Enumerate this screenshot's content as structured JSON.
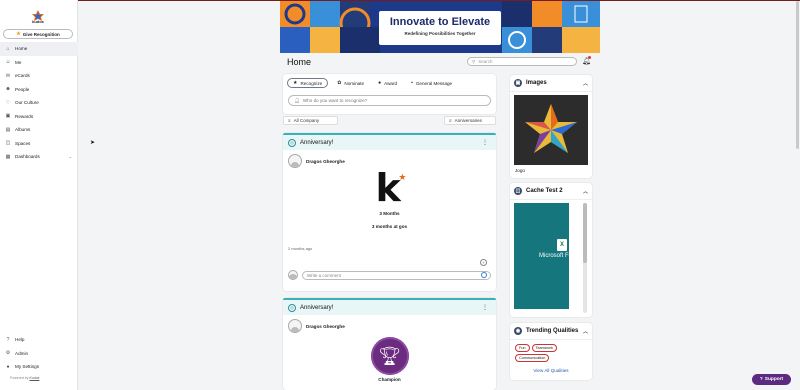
{
  "brand": {
    "logo_text": "kudos",
    "accent": "#e46b1a"
  },
  "sidebar": {
    "give_recognition": "Give Recognition",
    "items": [
      {
        "label": "Home",
        "icon": "home-icon",
        "glyph": "⌂",
        "active": true
      },
      {
        "label": "Me",
        "icon": "user-icon",
        "glyph": "☺"
      },
      {
        "label": "eCards",
        "icon": "envelope-icon",
        "glyph": "✉"
      },
      {
        "label": "People",
        "icon": "people-icon",
        "glyph": "☻"
      },
      {
        "label": "Our Culture",
        "icon": "heart-icon",
        "glyph": "♡"
      },
      {
        "label": "Rewards",
        "icon": "gift-icon",
        "glyph": "▣"
      },
      {
        "label": "Albums",
        "icon": "album-icon",
        "glyph": "▤"
      },
      {
        "label": "Spaces",
        "icon": "spaces-icon",
        "glyph": "◫"
      },
      {
        "label": "Dashboards",
        "icon": "dashboard-icon",
        "glyph": "▦",
        "expandable": true
      }
    ],
    "bottom_items": [
      {
        "label": "Help",
        "icon": "help-icon",
        "glyph": "?"
      },
      {
        "label": "Admin",
        "icon": "gear-icon",
        "glyph": "⚙"
      },
      {
        "label": "My Settings",
        "icon": "avatar-icon",
        "glyph": "●"
      }
    ],
    "powered_prefix": "Powered by",
    "powered_link": "Kudos"
  },
  "banner": {
    "title": "Innovate to Elevate",
    "subtitle": "Redefining Possibilities Together"
  },
  "header": {
    "title": "Home",
    "search_placeholder": "Search"
  },
  "composer": {
    "tabs": [
      {
        "label": "Recognize",
        "icon": "star-icon",
        "glyph": "★",
        "active": true
      },
      {
        "label": "Nominate",
        "icon": "ribbon-icon",
        "glyph": "✿"
      },
      {
        "label": "Award",
        "icon": "award-icon",
        "glyph": "●"
      },
      {
        "label": "General Message",
        "icon": "message-icon",
        "glyph": "▪"
      }
    ],
    "who_placeholder": "Who do you want to recognize?"
  },
  "filters": {
    "left": "All Company",
    "right": "Anniversaries"
  },
  "posts": [
    {
      "type": "Anniversary!",
      "author": "Dragos Gheorghe",
      "duration": "3 Months",
      "ago": "3 months at gos",
      "timestamp": "2 months ago",
      "comment_placeholder": "Write a comment"
    },
    {
      "type": "Anniversary!",
      "author": "Dragos Gheorghe",
      "badge": "Champion"
    }
  ],
  "widgets": {
    "images": {
      "title": "Images",
      "caption": "Jogo"
    },
    "cache": {
      "title": "Cache Test 2",
      "file_label": "Microsoft Fo",
      "file_glyph": "X"
    },
    "trending": {
      "title": "Trending Qualities",
      "qualities": [
        "Fun",
        "Teamwork",
        "Communication"
      ],
      "view_all": "View All Qualities"
    }
  },
  "support": {
    "label": "Support"
  }
}
